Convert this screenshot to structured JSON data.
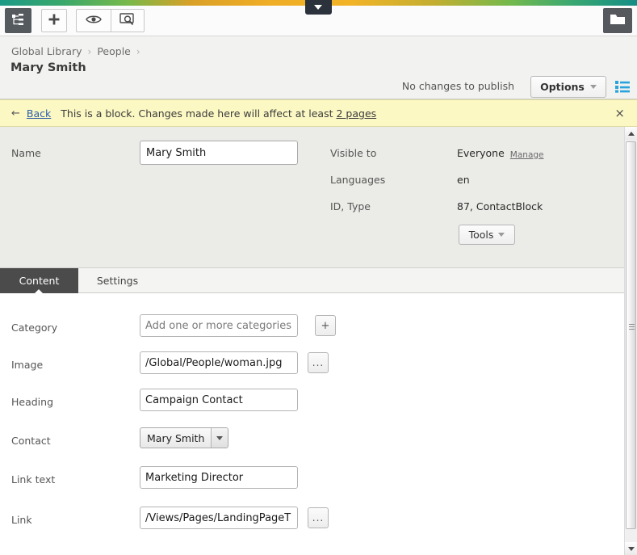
{
  "toolbar": {
    "tree_icon": "tree-structure-icon",
    "add_label": "+",
    "add_icon": "plus-icon",
    "preview_icon": "eye-icon",
    "inspect_icon": "preview-search-icon",
    "folder_icon": "folder-icon",
    "tab_caret_icon": "chevron-down-icon"
  },
  "header": {
    "breadcrumb": [
      {
        "label": "Global Library"
      },
      {
        "label": "People"
      }
    ],
    "separator": "›",
    "title": "Mary Smith",
    "publish_status": "No changes to publish",
    "options_label": "Options",
    "options_caret_icon": "chevron-down-icon",
    "list_icon": "list-view-icon",
    "list_icon_color": "#29a3dc"
  },
  "notice": {
    "back_arrow_icon": "arrow-left-icon",
    "back_label": "Back",
    "message_prefix": "This is a block. Changes made here will affect at least ",
    "pages_link": "2 pages",
    "close_label": "×",
    "background_color": "#fcf8c4"
  },
  "properties": {
    "name_label": "Name",
    "name_value": "Mary Smith",
    "visible_to_label": "Visible to",
    "visible_to_value": "Everyone",
    "manage_link": "Manage",
    "languages_label": "Languages",
    "languages_value": "en",
    "id_type_label": "ID, Type",
    "id_type_value": "87, ContactBlock",
    "tools_label": "Tools",
    "tools_caret_icon": "chevron-down-icon"
  },
  "tabs": [
    {
      "label": "Content",
      "active": true
    },
    {
      "label": "Settings",
      "active": false
    }
  ],
  "form": {
    "fields": [
      {
        "label": "Category",
        "type": "text",
        "value": "",
        "placeholder": "Add one or more categories",
        "button": "+",
        "button_name": "add-category-button"
      },
      {
        "label": "Image",
        "type": "text",
        "value": "/Global/People/woman.jpg",
        "placeholder": "",
        "button": "...",
        "button_name": "browse-image-button"
      },
      {
        "label": "Heading",
        "type": "text",
        "value": "Campaign Contact",
        "placeholder": "",
        "button": null,
        "button_name": null
      },
      {
        "label": "Contact",
        "type": "select",
        "value": "Mary Smith",
        "placeholder": "",
        "button": null,
        "button_name": null
      },
      {
        "label": "Link text",
        "type": "text",
        "value": "Marketing Director",
        "placeholder": "",
        "button": null,
        "button_name": null
      },
      {
        "label": "Link",
        "type": "text",
        "value": "/Views/Pages/LandingPageT",
        "placeholder": "",
        "button": "...",
        "button_name": "browse-link-button"
      }
    ]
  },
  "scrollbar": {
    "up_icon": "triangle-up-icon",
    "down_icon": "triangle-down-icon"
  }
}
